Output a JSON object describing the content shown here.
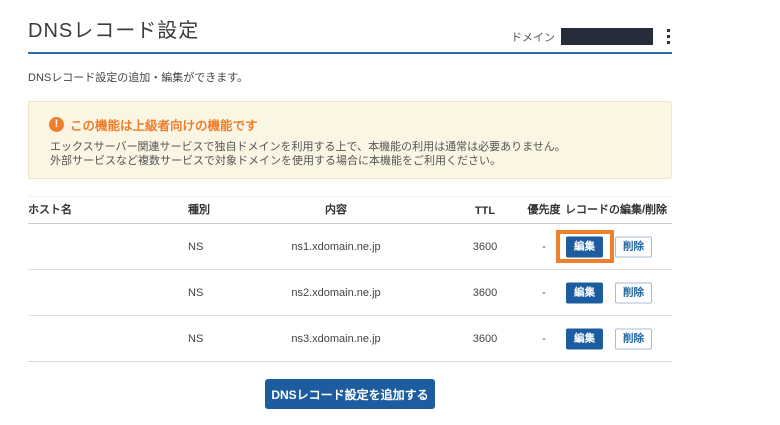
{
  "page": {
    "title": "DNSレコード設定",
    "subtitle": "DNSレコード設定の追加・編集ができます。",
    "domain_label": "ドメイン"
  },
  "icons": {
    "kebab_menu": "vertical three-dot menu",
    "warning": "!"
  },
  "notice": {
    "title": "この機能は上級者向けの機能です",
    "line1": "エックスサーバー関連サービスで独自ドメインを利用する上で、本機能の利用は通常は必要ありません。",
    "line2": "外部サービスなど複数サービスで対象ドメインを使用する場合に本機能をご利用ください。"
  },
  "table": {
    "headers": {
      "host": "ホスト名",
      "type": "種別",
      "content": "内容",
      "ttl": "TTL",
      "priority": "優先度",
      "actions": "レコードの編集/削除"
    },
    "rows": [
      {
        "type": "NS",
        "content": "ns1.xdomain.ne.jp",
        "ttl": "3600",
        "priority": "-",
        "edit": "編集",
        "delete": "削除",
        "highlighted": true
      },
      {
        "type": "NS",
        "content": "ns2.xdomain.ne.jp",
        "ttl": "3600",
        "priority": "-",
        "edit": "編集",
        "delete": "削除",
        "highlighted": false
      },
      {
        "type": "NS",
        "content": "ns3.xdomain.ne.jp",
        "ttl": "3600",
        "priority": "-",
        "edit": "編集",
        "delete": "削除",
        "highlighted": false
      }
    ]
  },
  "footer": {
    "add_button": "DNSレコード設定を追加する"
  },
  "colors": {
    "accent_blue": "#1d5d9f",
    "header_line_blue": "#2c6ba3",
    "annotation_orange": "#ee7f2d",
    "notice_background": "#fbf5e3",
    "redacted_hostname_gray": "#847e77",
    "redacted_domain_navy": "#262c3a"
  }
}
